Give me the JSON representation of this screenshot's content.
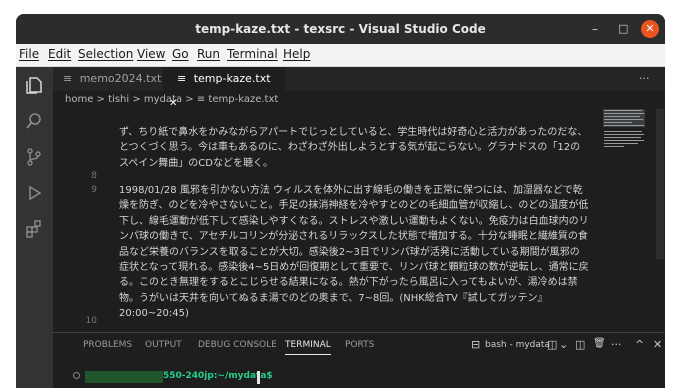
{
  "window": {
    "title": "temp-kaze.txt - texsrc - Visual Studio Code",
    "min": "–",
    "max": "□",
    "close": "✕"
  },
  "menu": [
    "File",
    "Edit",
    "Selection",
    "View",
    "Go",
    "Run",
    "Terminal",
    "Help"
  ],
  "tabs": [
    {
      "label": "memo2024.txt",
      "icon": "≡",
      "close": ""
    },
    {
      "label": "temp-kaze.txt",
      "icon": "≡",
      "close": "✕"
    }
  ],
  "tabbar_more": "···",
  "breadcrumb": [
    "home",
    "tishi",
    "mydata",
    "≡ temp-kaze.txt"
  ],
  "breadcrumb_sep": ">",
  "editor": {
    "lines": [
      {
        "num": "",
        "text": "ず、ちり紙で鼻水をかみながらアパートでじっとしていると、学生時代は好奇心と活力があったのだな、とつくづく思う。今は車もあるのに、わざわざ外出しようとする気が起こらない。グラナドスの「12のスペイン舞曲」のCDなどを聴く。"
      },
      {
        "num": "8",
        "text": ""
      },
      {
        "num": "9",
        "text": "1998/01/28 風邪を引かない方法 ウィルスを体外に出す線毛の働きを正常に保つには、加湿器などで乾燥を防ぎ、のどを冷やさないこと。手足の抹消神経を冷やすとのどの毛細血管が収縮し、のどの温度が低下し、線毛運動が低下して感染しやすくなる。ストレスや激しい運動もよくない。免疫力は白血球内のリンパ球の働きで、アセチルコリンが分泌されるリラックスした状態で増加する。十分な睡眠と繊維質の食品など栄養のバランスを取ることが大切。感染後2~3日でリンパ球が活発に活動している期間が風邪の症状となって現れる。感染後4~5日めが回復期として重要で、リンパ球と顆粒球の数が逆転し、通常に戻る。このとき無理をするとこじらせる結果になる。熱が下がったら風呂に入ってもよいが、湯冷めは禁物。うがいは天井を向いてぬるま湯でのどの奥まで、7~8回。(NHK総合TV『試してガッテン』20:00~20:45)"
      },
      {
        "num": "10",
        "text": ""
      }
    ]
  },
  "panel": {
    "tabs": [
      "PROBLEMS",
      "OUTPUT",
      "DEBUG CONSOLE",
      "TERMINAL",
      "PORTS"
    ],
    "active_tab": "TERMINAL",
    "terminal_name": "bash - mydata",
    "icons": {
      "term": "⊟",
      "split": "◫",
      "chev": "⌄",
      "trash": "🗑",
      "more": "···",
      "up": "^",
      "close": "✕"
    },
    "prompt": "550-240jp:~/mydata$"
  },
  "colors": {
    "accent_close": "#e95420",
    "prompt_green": "#23d18b",
    "prompt_blue": "#3b8eea"
  }
}
